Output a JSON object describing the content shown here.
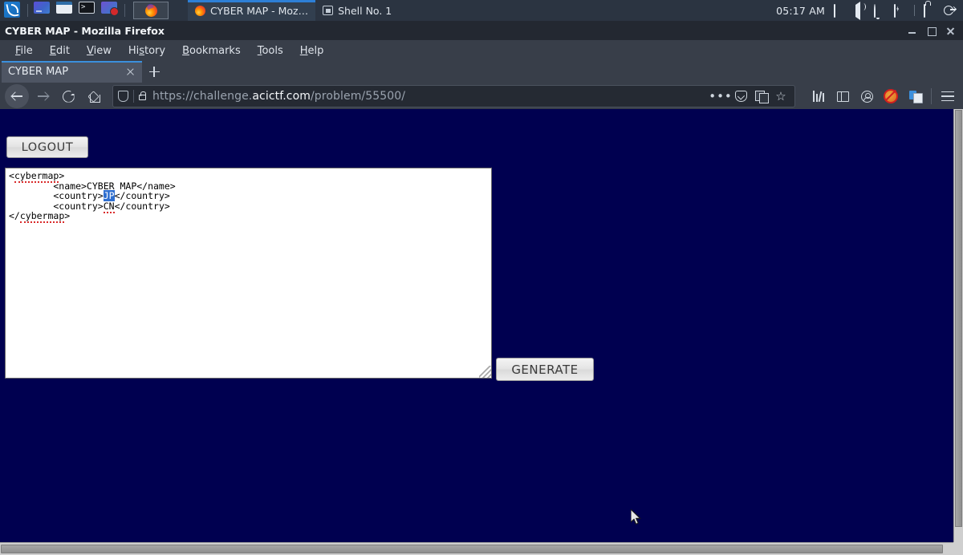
{
  "taskbar": {
    "launchers": [
      {
        "name": "kali-menu-icon",
        "label": "Kali Menu"
      },
      {
        "name": "app-launcher-icon",
        "label": "Applications"
      },
      {
        "name": "file-manager-icon",
        "label": "File Manager"
      },
      {
        "name": "terminal-icon",
        "label": "Terminal"
      },
      {
        "name": "screen-recorder-icon",
        "label": "Screen Recorder"
      }
    ],
    "active_launcher": {
      "name": "firefox-launcher-icon",
      "label": "Firefox"
    },
    "windows": [
      {
        "name": "taskbar-window-firefox",
        "label": "CYBER MAP - Moz…",
        "active": true,
        "icon": "firefox-icon"
      },
      {
        "name": "taskbar-window-shell",
        "label": "Shell No. 1",
        "active": false,
        "icon": "terminal-icon"
      }
    ],
    "clock": "05:17 AM",
    "tray": [
      {
        "name": "display-icon"
      },
      {
        "name": "volume-icon"
      },
      {
        "name": "notification-bell-icon"
      },
      {
        "name": "battery-icon"
      },
      {
        "name": "lock-icon"
      },
      {
        "name": "power-logout-icon"
      }
    ]
  },
  "browser": {
    "window_title": "CYBER MAP - Mozilla Firefox",
    "window_buttons": [
      "minimize",
      "maximize",
      "close"
    ],
    "menus": [
      {
        "label": "File",
        "accel": "F"
      },
      {
        "label": "Edit",
        "accel": "E"
      },
      {
        "label": "View",
        "accel": "V"
      },
      {
        "label": "History",
        "accel": "s"
      },
      {
        "label": "Bookmarks",
        "accel": "B"
      },
      {
        "label": "Tools",
        "accel": "T"
      },
      {
        "label": "Help",
        "accel": "H"
      }
    ],
    "tabs": [
      {
        "label": "CYBER MAP",
        "active": true
      }
    ],
    "new_tab_label": "+",
    "nav": {
      "back": "back-button",
      "forward": "forward-button",
      "reload": "reload-button",
      "home": "home-button"
    },
    "url": {
      "prefix": "https://challenge.",
      "host": "acictf.com",
      "suffix": "/problem/55500/",
      "full": "https://challenge.acictf.com/problem/55500/"
    },
    "url_actions": [
      "page-actions-icon",
      "pocket-icon",
      "save-to-reading-icon",
      "bookmark-star-icon"
    ],
    "toolbar_right": [
      "library-icon",
      "sidebar-icon",
      "account-icon",
      "noscript-icon",
      "cookie-manager-icon",
      "app-menu-icon"
    ]
  },
  "page": {
    "logout_label": "LOGOUT",
    "generate_label": "GENERATE",
    "xml_lines": [
      {
        "text": "<cybermap>",
        "parts": [
          {
            "t": "<",
            "k": "n"
          },
          {
            "t": "cybermap",
            "k": "sq"
          },
          {
            "t": ">",
            "k": "n"
          }
        ]
      },
      {
        "text": "        <name>CYBER MAP</name>",
        "parts": [
          {
            "t": "        <name>CYBER MAP</name>",
            "k": "n"
          }
        ]
      },
      {
        "text": "        <country>JP</country>",
        "parts": [
          {
            "t": "        <country>",
            "k": "n"
          },
          {
            "t": "JP",
            "k": "sel"
          },
          {
            "t": "</country>",
            "k": "n"
          }
        ]
      },
      {
        "text": "        <country>CN</country>",
        "parts": [
          {
            "t": "        <country>",
            "k": "n"
          },
          {
            "t": "CN",
            "k": "sq"
          },
          {
            "t": "</country>",
            "k": "n"
          }
        ]
      },
      {
        "text": "</cybermap>",
        "parts": [
          {
            "t": "</",
            "k": "n"
          },
          {
            "t": "cybermap",
            "k": "sq"
          },
          {
            "t": ">",
            "k": "n"
          }
        ]
      }
    ],
    "selected_text": "JP",
    "background_color": "#000050",
    "textarea_background": "#ffffff",
    "selection_color": "#2f6fd0"
  }
}
